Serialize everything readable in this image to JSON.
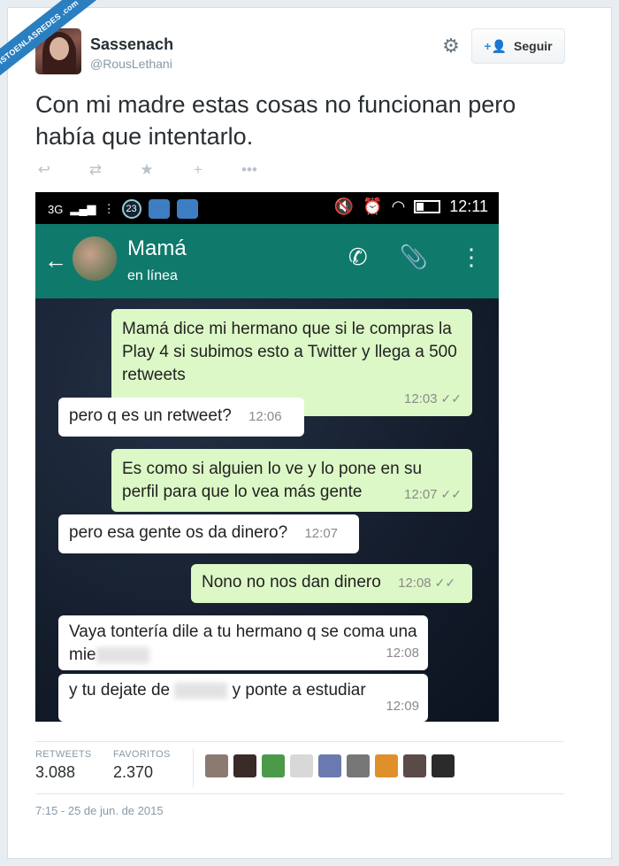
{
  "watermark": "VISTOENLASREDES .com",
  "user": {
    "name": "Sassenach",
    "handle": "@RousLethani"
  },
  "header": {
    "follow_label": "Seguir"
  },
  "tweet": {
    "text": "Con mi madre estas cosas no funcionan pero había que intentarlo."
  },
  "icons": [
    "reply-icon",
    "retweet-icon",
    "favorite-icon",
    "follow-icon",
    "more-icon",
    "gear-icon"
  ],
  "phone": {
    "status": {
      "network": "3G",
      "badge": "23",
      "time": "12:11"
    },
    "chat": {
      "contact": "Mamá",
      "presence": "en línea",
      "messages": [
        {
          "dir": "out",
          "text": "Mamá dice mi hermano que si le compras la Play 4 si subimos esto a Twitter y llega a 500 retweets",
          "time": "12:03"
        },
        {
          "dir": "in",
          "text": "pero q es un retweet?",
          "time": "12:06"
        },
        {
          "dir": "out",
          "text": "Es como si alguien lo ve y lo pone en su perfil para que lo vea más gente",
          "time": "12:07"
        },
        {
          "dir": "in",
          "text": "pero esa gente os da dinero?",
          "time": "12:07"
        },
        {
          "dir": "out",
          "text": "Nono no nos dan dinero",
          "time": "12:08"
        },
        {
          "dir": "in",
          "text_a": "Vaya tontería dile a tu hermano q se coma una mie",
          "time": "12:08"
        },
        {
          "dir": "in",
          "text_a": "y tu dejate de",
          "text_b": "y ponte a estudiar",
          "time": "12:09"
        }
      ]
    }
  },
  "stats": {
    "retweets_label": "RETWEETS",
    "retweets": "3.088",
    "favorites_label": "FAVORITOS",
    "favorites": "2.370"
  },
  "timestamp": "7:15 - 25 de jun. de 2015",
  "colors": {
    "accent": "#2a7fc1",
    "whatsapp_header": "#0f7a6c",
    "outgoing_bubble": "#dcf8c6"
  }
}
